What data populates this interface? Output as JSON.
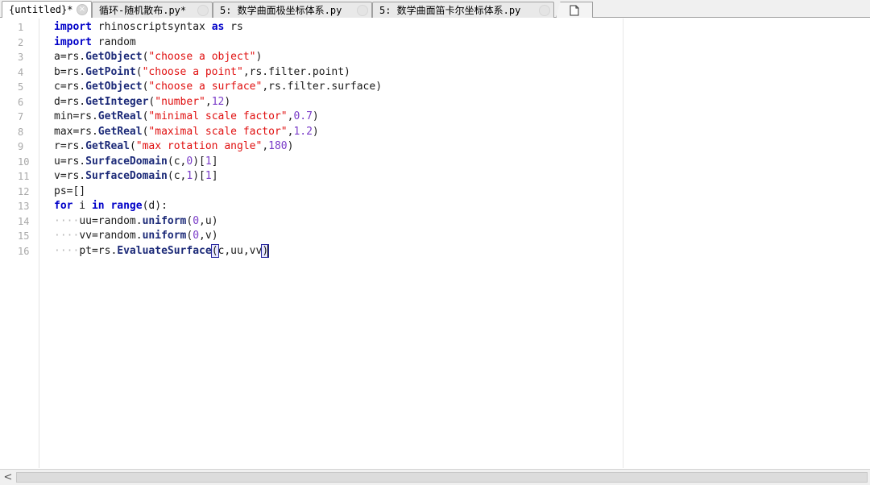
{
  "tabs": [
    {
      "label": "{untitled}*",
      "active": true
    },
    {
      "label": "循环-随机散布.py*",
      "active": false
    },
    {
      "label": "5: 数学曲面极坐标体系.py",
      "active": false
    },
    {
      "label": "5: 数学曲面笛卡尔坐标体系.py",
      "active": false
    }
  ],
  "icons": {
    "tab_close": "close-icon",
    "new_tab": "new-document-icon",
    "scroll_left": "chevron-left-icon"
  },
  "close_glyph": "×",
  "scroll_left_glyph": "<",
  "editor": {
    "line_numbers": [
      "1",
      "2",
      "3",
      "4",
      "5",
      "6",
      "7",
      "8",
      "9",
      "10",
      "11",
      "12",
      "13",
      "14",
      "15",
      "16"
    ],
    "lines": [
      [
        {
          "t": "import",
          "c": "kw"
        },
        {
          "t": " rhinoscriptsyntax "
        },
        {
          "t": "as",
          "c": "kw"
        },
        {
          "t": " rs"
        }
      ],
      [
        {
          "t": "import",
          "c": "kw"
        },
        {
          "t": " random"
        }
      ],
      [
        {
          "t": "a=rs."
        },
        {
          "t": "GetObject",
          "c": "fn"
        },
        {
          "t": "("
        },
        {
          "t": "\"choose a object\"",
          "c": "str"
        },
        {
          "t": ")"
        }
      ],
      [
        {
          "t": "b=rs."
        },
        {
          "t": "GetPoint",
          "c": "fn"
        },
        {
          "t": "("
        },
        {
          "t": "\"choose a point\"",
          "c": "str"
        },
        {
          "t": ",rs.filter.point)"
        }
      ],
      [
        {
          "t": "c=rs."
        },
        {
          "t": "GetObject",
          "c": "fn"
        },
        {
          "t": "("
        },
        {
          "t": "\"choose a surface\"",
          "c": "str"
        },
        {
          "t": ",rs.filter.surface)"
        }
      ],
      [
        {
          "t": "d=rs."
        },
        {
          "t": "GetInteger",
          "c": "fn"
        },
        {
          "t": "("
        },
        {
          "t": "\"number\"",
          "c": "str"
        },
        {
          "t": ","
        },
        {
          "t": "12",
          "c": "num"
        },
        {
          "t": ")"
        }
      ],
      [
        {
          "t": "min=rs."
        },
        {
          "t": "GetReal",
          "c": "fn"
        },
        {
          "t": "("
        },
        {
          "t": "\"minimal scale factor\"",
          "c": "str"
        },
        {
          "t": ","
        },
        {
          "t": "0.7",
          "c": "num"
        },
        {
          "t": ")"
        }
      ],
      [
        {
          "t": "max=rs."
        },
        {
          "t": "GetReal",
          "c": "fn"
        },
        {
          "t": "("
        },
        {
          "t": "\"maximal scale factor\"",
          "c": "str"
        },
        {
          "t": ","
        },
        {
          "t": "1.2",
          "c": "num"
        },
        {
          "t": ")"
        }
      ],
      [
        {
          "t": "r=rs."
        },
        {
          "t": "GetReal",
          "c": "fn"
        },
        {
          "t": "("
        },
        {
          "t": "\"max rotation angle\"",
          "c": "str"
        },
        {
          "t": ","
        },
        {
          "t": "180",
          "c": "num"
        },
        {
          "t": ")"
        }
      ],
      [
        {
          "t": "u=rs."
        },
        {
          "t": "SurfaceDomain",
          "c": "fn"
        },
        {
          "t": "(c,"
        },
        {
          "t": "0",
          "c": "num"
        },
        {
          "t": ")["
        },
        {
          "t": "1",
          "c": "num"
        },
        {
          "t": "]"
        }
      ],
      [
        {
          "t": "v=rs."
        },
        {
          "t": "SurfaceDomain",
          "c": "fn"
        },
        {
          "t": "(c,"
        },
        {
          "t": "1",
          "c": "num"
        },
        {
          "t": ")["
        },
        {
          "t": "1",
          "c": "num"
        },
        {
          "t": "]"
        }
      ],
      [
        {
          "t": "ps=[]"
        }
      ],
      [
        {
          "t": "for",
          "c": "kw"
        },
        {
          "t": " i "
        },
        {
          "t": "in",
          "c": "kw"
        },
        {
          "t": " "
        },
        {
          "t": "range",
          "c": "kw"
        },
        {
          "t": "(d):"
        }
      ],
      [
        {
          "t": "····",
          "c": "ws"
        },
        {
          "t": "uu=random."
        },
        {
          "t": "uniform",
          "c": "fn"
        },
        {
          "t": "("
        },
        {
          "t": "0",
          "c": "num"
        },
        {
          "t": ",u)"
        }
      ],
      [
        {
          "t": "····",
          "c": "ws"
        },
        {
          "t": "vv=random."
        },
        {
          "t": "uniform",
          "c": "fn"
        },
        {
          "t": "("
        },
        {
          "t": "0",
          "c": "num"
        },
        {
          "t": ",v)"
        }
      ],
      [
        {
          "t": "····",
          "c": "ws"
        },
        {
          "t": "pt=rs."
        },
        {
          "t": "EvaluateSurface",
          "c": "fn"
        },
        {
          "t": "(",
          "c": "brace"
        },
        {
          "t": "c,uu,vv"
        },
        {
          "t": ")",
          "c": "brace"
        },
        {
          "t": "",
          "c": "cursor"
        }
      ]
    ]
  }
}
